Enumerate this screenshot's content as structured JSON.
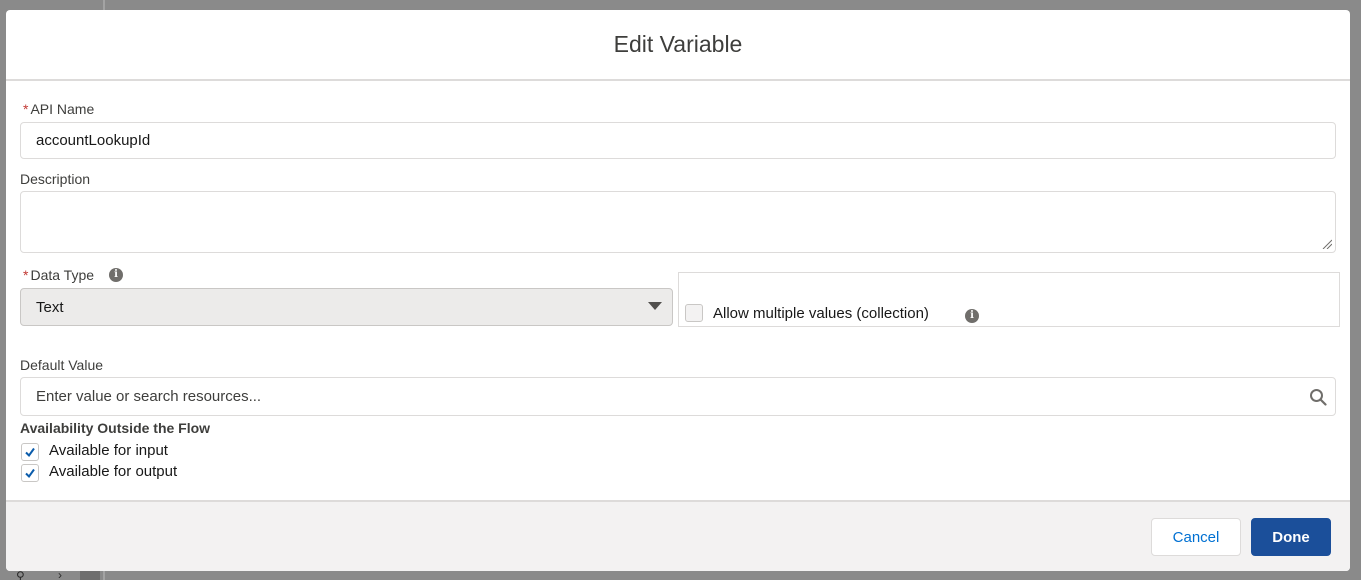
{
  "modal": {
    "title": "Edit Variable"
  },
  "fields": {
    "api_name": {
      "label": "API Name",
      "required_marker": "*",
      "value": "accountLookupId"
    },
    "description": {
      "label": "Description",
      "value": ""
    },
    "data_type": {
      "label": "Data Type",
      "required_marker": "*",
      "selected": "Text"
    },
    "collection": {
      "label": "Allow multiple values (collection)",
      "checked": false
    },
    "default_value": {
      "label": "Default Value",
      "placeholder": "Enter value or search resources..."
    }
  },
  "availability": {
    "title": "Availability Outside the Flow",
    "input_label": "Available for input",
    "input_checked": true,
    "output_label": "Available for output",
    "output_checked": true
  },
  "footer": {
    "cancel_label": "Cancel",
    "done_label": "Done"
  },
  "colors": {
    "brand": "#1b4f9a",
    "link": "#0070d2",
    "required": "#c23934"
  },
  "icons": {
    "info": "info-icon",
    "search": "search-icon",
    "dropdown": "chevron-down-icon",
    "check": "checkmark-icon"
  }
}
